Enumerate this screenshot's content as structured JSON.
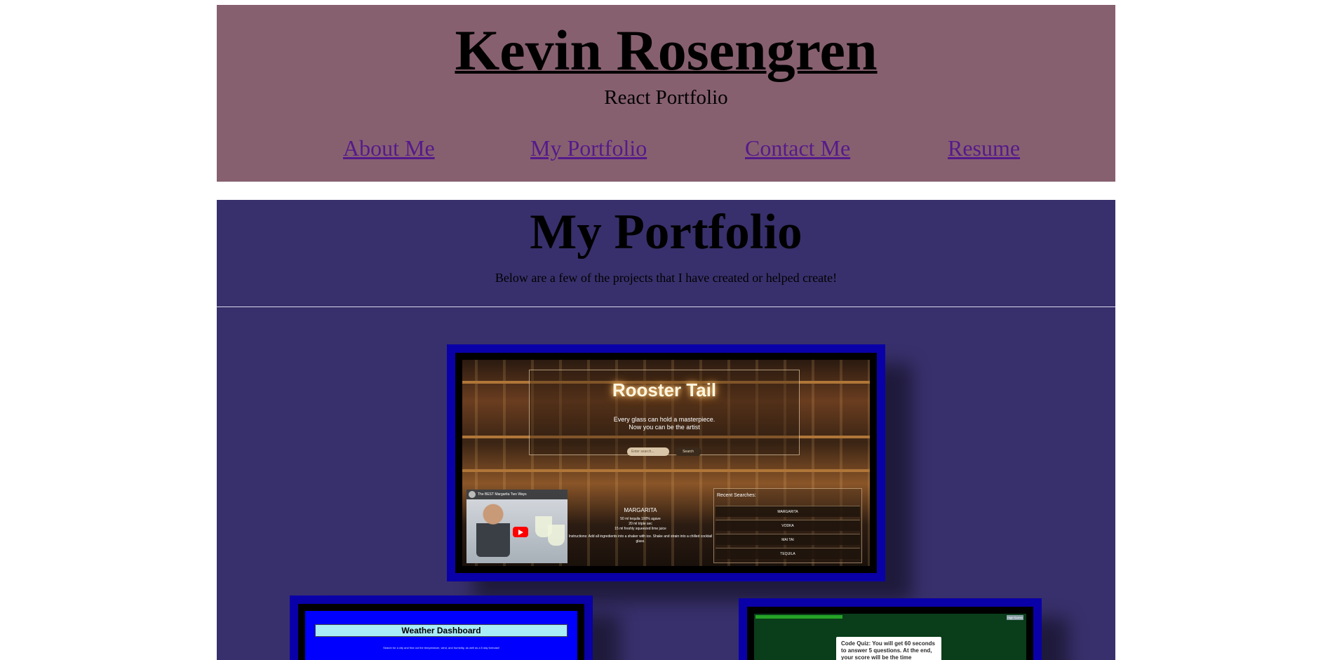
{
  "header": {
    "title": "Kevin Rosengren",
    "subtitle": "React Portfolio",
    "nav": [
      "About Me",
      "My Portfolio",
      "Contact Me",
      "Resume"
    ],
    "background": "#87606f",
    "link_color": "#551a8b"
  },
  "portfolio": {
    "title": "My Portfolio",
    "intro": "Below are a few of the projects that I have created or helped create!",
    "background": "#38306c",
    "card_border_color": "#0a00a8",
    "projects": [
      {
        "name": "Rooster Tail",
        "tagline": [
          "Every glass can hold a masterpiece.",
          "Now you can be the artist"
        ],
        "search_placeholder": "Enter search...",
        "search_button": "Search",
        "video_title": "The BEST Margarita Two Ways",
        "recipe_name": "MARGARITA",
        "ingredients": [
          "50 ml tequila 100% agave",
          "20 ml triple sec",
          "15 ml freshly squeezed lime juice"
        ],
        "instructions": "Instructions: Add all ingredients into a shaker with ice. Shake and strain into a chilled cocktail glass.",
        "recent_label": "Recent Searches:",
        "recent_searches": [
          "MARGARITA",
          "VODKA",
          "MAI TAI",
          "TEQUILA"
        ]
      },
      {
        "name": "Weather Dashboard",
        "note": "Search for a city and find out the temperature, wind, and humidity, as well as a 5 day forecast!"
      },
      {
        "name": "Code Quiz",
        "card_text": "Code Quiz: You will get 60 seconds to answer 5 questions. At the end, your score will be the time remaining, but",
        "corner_button": "High Scores"
      }
    ]
  }
}
